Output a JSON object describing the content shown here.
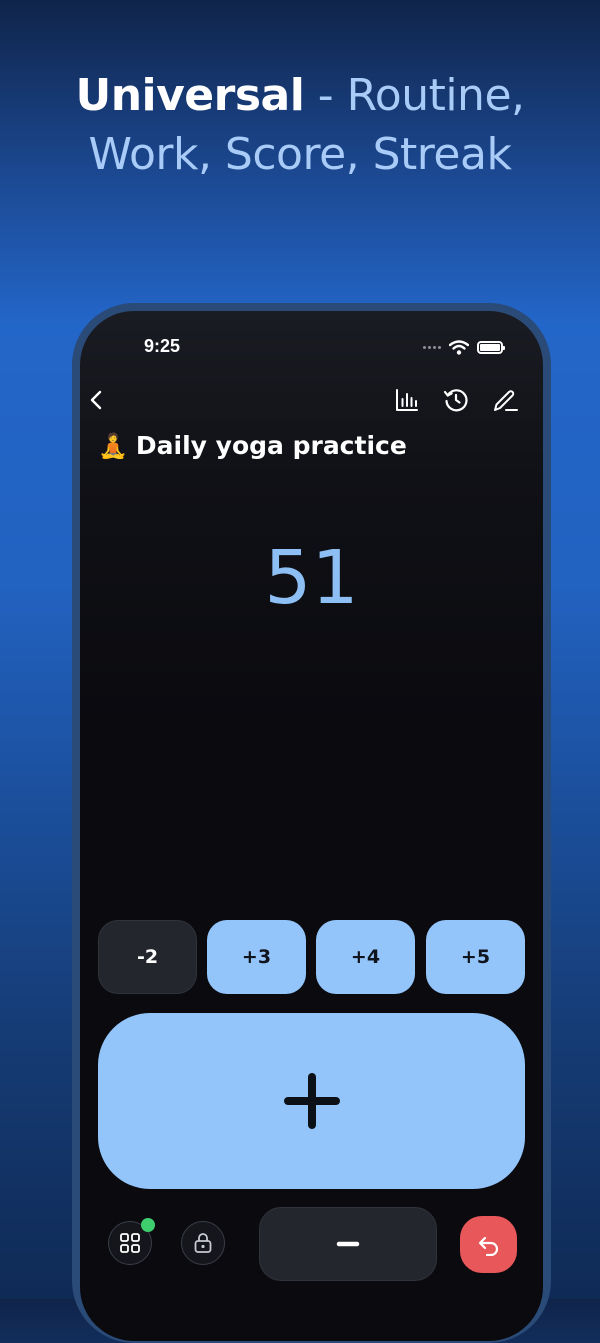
{
  "headline": {
    "part1": "Universal",
    "separator": " - ",
    "part2": "Routine,",
    "line2": "Work, Score, Streak"
  },
  "status_bar": {
    "time": "9:25",
    "icons": [
      "signal-dots-icon",
      "wifi-icon",
      "battery-icon"
    ]
  },
  "nav": {
    "back_icon": "chevron-left-icon",
    "actions": [
      "bar-chart-icon",
      "history-icon",
      "edit-pencil-icon"
    ]
  },
  "counter_screen": {
    "emoji": "🧘",
    "title": "Daily yoga practice",
    "count": "51"
  },
  "step_buttons": [
    "-2",
    "+3",
    "+4",
    "+5"
  ],
  "main_increment_icon": "plus-icon",
  "bottom_bar": {
    "icons": [
      "grid-icon",
      "lock-icon",
      "minus-icon",
      "undo-icon"
    ],
    "notification_dot_color": "#3fce6e"
  },
  "colors": {
    "accent": "#93c5fa",
    "counter": "#8dbff5",
    "undo": "#e8585a",
    "headline_highlight": "#a8ccf7"
  }
}
